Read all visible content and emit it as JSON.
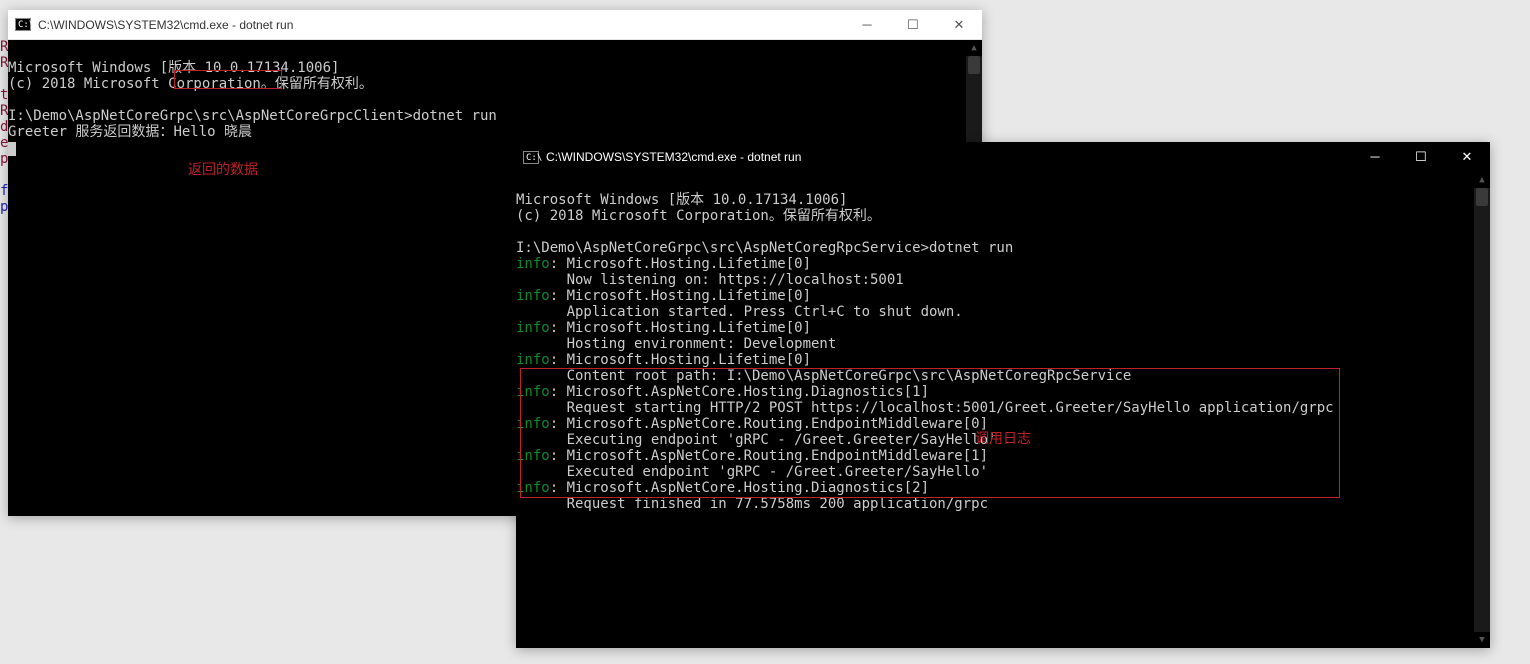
{
  "sidebar": [
    "R",
    "R",
    "",
    "t",
    "R",
    "d",
    "e",
    "p",
    "",
    "f",
    "p"
  ],
  "win1": {
    "title": "C:\\WINDOWS\\SYSTEM32\\cmd.exe - dotnet   run",
    "l1": "Microsoft Windows [版本 10.0.17134.1006]",
    "l2": "(c) 2018 Microsoft Corporation。保留所有权利。",
    "l3": "",
    "l4": "I:\\Demo\\AspNetCoreGrpc\\src\\AspNetCoreGrpcClient>dotnet run",
    "l5a": "Greeter 服务返回数据：",
    "l5b": "Hello 晓晨",
    "annot": "返回的数据"
  },
  "win2": {
    "title": "C:\\WINDOWS\\SYSTEM32\\cmd.exe - dotnet   run",
    "l1": "Microsoft Windows [版本 10.0.17134.1006]",
    "l2": "(c) 2018 Microsoft Corporation。保留所有权利。",
    "l3": "",
    "l4": "I:\\Demo\\AspNetCoreGrpc\\src\\AspNetCoregRpcService>dotnet run",
    "info": "info",
    "s1a": ": Microsoft.Hosting.Lifetime[0]",
    "s1b": "      Now listening on: https://localhost:5001",
    "s2a": ": Microsoft.Hosting.Lifetime[0]",
    "s2b": "      Application started. Press Ctrl+C to shut down.",
    "s3a": ": Microsoft.Hosting.Lifetime[0]",
    "s3b": "      Hosting environment: Development",
    "s4a": ": Microsoft.Hosting.Lifetime[0]",
    "s4b": "      Content root path: I:\\Demo\\AspNetCoreGrpc\\src\\AspNetCoregRpcService",
    "s5a": ": Microsoft.AspNetCore.Hosting.Diagnostics[1]",
    "s5b": "      Request starting HTTP/2 POST https://localhost:5001/Greet.Greeter/SayHello application/grpc ",
    "s6a": ": Microsoft.AspNetCore.Routing.EndpointMiddleware[0]",
    "s6b": "      Executing endpoint 'gRPC - /Greet.Greeter/SayHello'",
    "s7a": ": Microsoft.AspNetCore.Routing.EndpointMiddleware[1]",
    "s7b": "      Executed endpoint 'gRPC - /Greet.Greeter/SayHello'",
    "s8a": ": Microsoft.AspNetCore.Hosting.Diagnostics[2]",
    "s8b": "      Request finished in 77.5758ms 200 application/grpc ",
    "annot": "调用日志"
  }
}
